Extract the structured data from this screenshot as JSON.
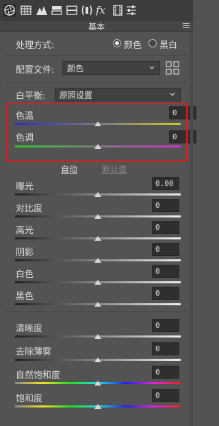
{
  "panel": {
    "title": "基本"
  },
  "toolbar": {
    "icons": [
      "aperture-icon",
      "grid-icon",
      "mountains-icon",
      "split-panel-icon",
      "panel-icon",
      "lens-icon",
      "fx-icon",
      "film-icon",
      "sliders-icon"
    ]
  },
  "treatment": {
    "label": "处理方式:",
    "options": [
      "颜色",
      "黑白"
    ],
    "selected": "颜色"
  },
  "profile": {
    "label": "配置文件:",
    "value": "颜色"
  },
  "white_balance": {
    "label": "白平衡:",
    "value": "原照设置"
  },
  "sliders_wb": [
    {
      "label": "色温",
      "value": "0",
      "level": 0.5
    },
    {
      "label": "色调",
      "value": "0",
      "level": 0.5
    }
  ],
  "tone_links": {
    "auto": "自动",
    "default": "默认值"
  },
  "sliders_tone": [
    {
      "label": "曝光",
      "value": "0.00",
      "level": 0.5
    },
    {
      "label": "对比度",
      "value": "0",
      "level": 0.5
    },
    {
      "label": "高光",
      "value": "0",
      "level": 0.5
    },
    {
      "label": "阴影",
      "value": "0",
      "level": 0.5
    },
    {
      "label": "白色",
      "value": "0",
      "level": 0.5
    },
    {
      "label": "黑色",
      "value": "0",
      "level": 0.5
    }
  ],
  "sliders_presence": [
    {
      "label": "清晰度",
      "value": "0",
      "level": 0.5
    },
    {
      "label": "去除薄雾",
      "value": "0",
      "level": 0.5
    },
    {
      "label": "自然饱和度",
      "value": "0",
      "level": 0.5
    },
    {
      "label": "饱和度",
      "value": "0",
      "level": 0.5
    }
  ],
  "colors": {
    "temp_gradient": [
      "#2a2ad0",
      "#c8c830"
    ],
    "tint_gradient": [
      "#2ec82e",
      "#d030d0"
    ],
    "highlight_box": "#d61f1f"
  }
}
